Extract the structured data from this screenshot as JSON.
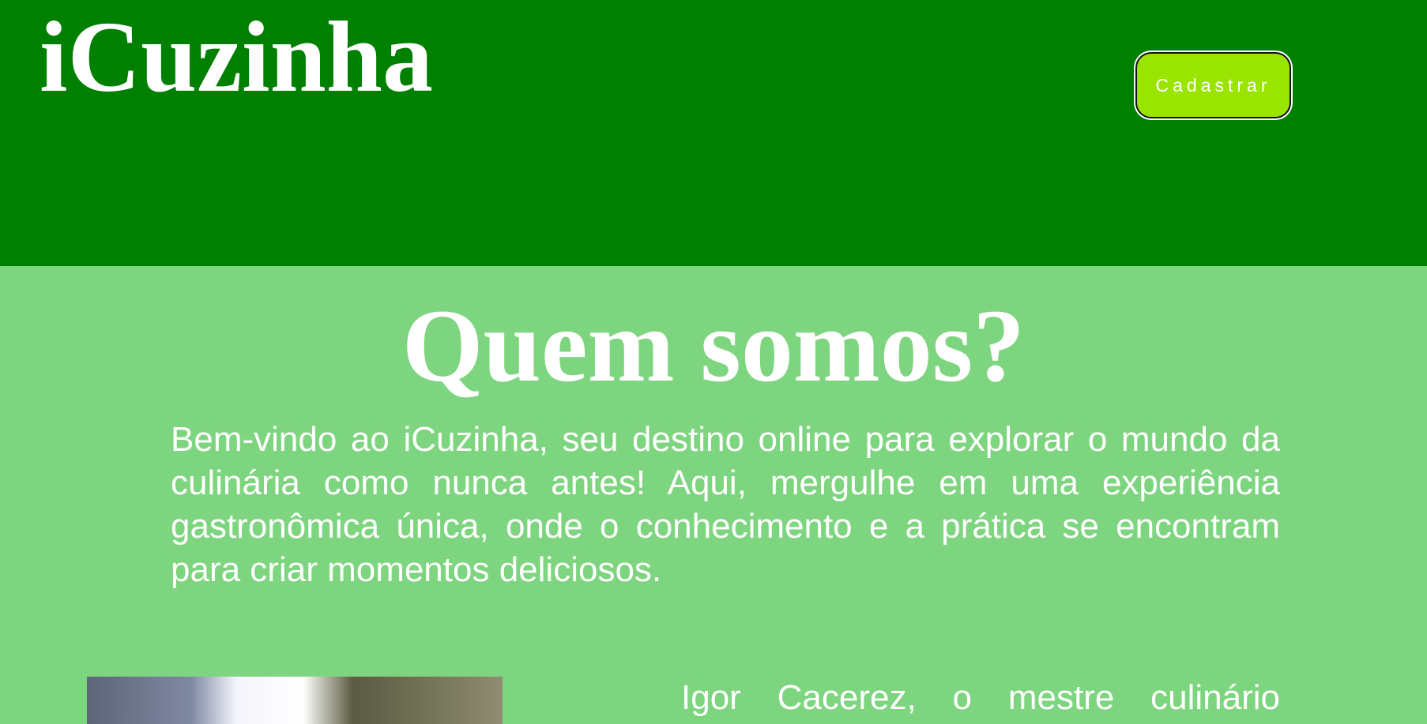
{
  "header": {
    "brand": "iCuzinha",
    "signup_label": "Cadastrar",
    "background_color": "#008000",
    "button_color": "#99e400"
  },
  "about": {
    "title": "Quem somos?",
    "text": "Bem-vindo ao iCuzinha, seu destino online para explorar o mundo da culinária como nunca antes! Aqui, mergulhe em uma experiência gastronômica única, onde o conhecimento e a prática se encontram para criar momentos deliciosos.",
    "background_color": "#7ed57f"
  },
  "chef": {
    "text": "Igor Cacerez, o mestre culinário"
  }
}
